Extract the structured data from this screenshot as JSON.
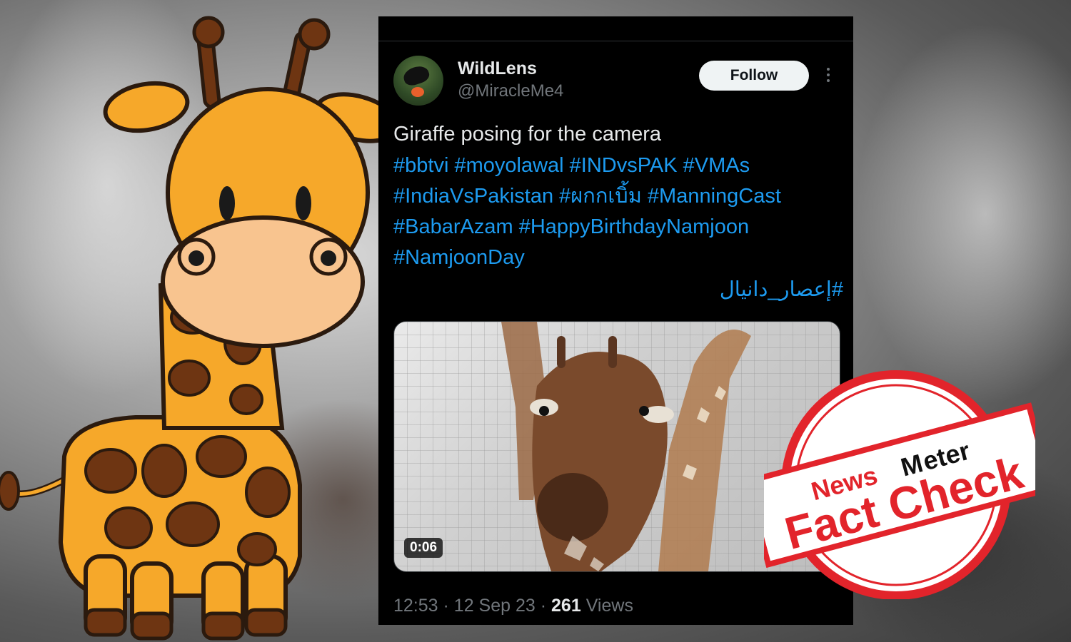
{
  "tweet": {
    "display_name": "WildLens",
    "handle": "@MiracleMe4",
    "follow_label": "Follow",
    "text": "Giraffe posing for the camera",
    "hashtags": [
      "#bbtvi",
      "#moyolawal",
      "#INDvsPAK",
      "#VMAs",
      "#IndiaVsPakistan",
      "#ผกกเบิ้ม",
      "#ManningCast",
      "#BabarAzam",
      "#HappyBirthdayNamjoon",
      "#NamjoonDay"
    ],
    "hashtag_arabic": "#إعصار_دانيال",
    "video_duration": "0:06",
    "time": "12:53",
    "date": "12 Sep 23",
    "views_count": "261",
    "views_label": "Views"
  },
  "stamp": {
    "brand_left": "News",
    "brand_right": "eter",
    "label": "Fact Check",
    "color": "#e2242b"
  },
  "colors": {
    "accent": "#1d9bf0",
    "giraffe": "#f6a82a",
    "spots": "#6e3512"
  }
}
